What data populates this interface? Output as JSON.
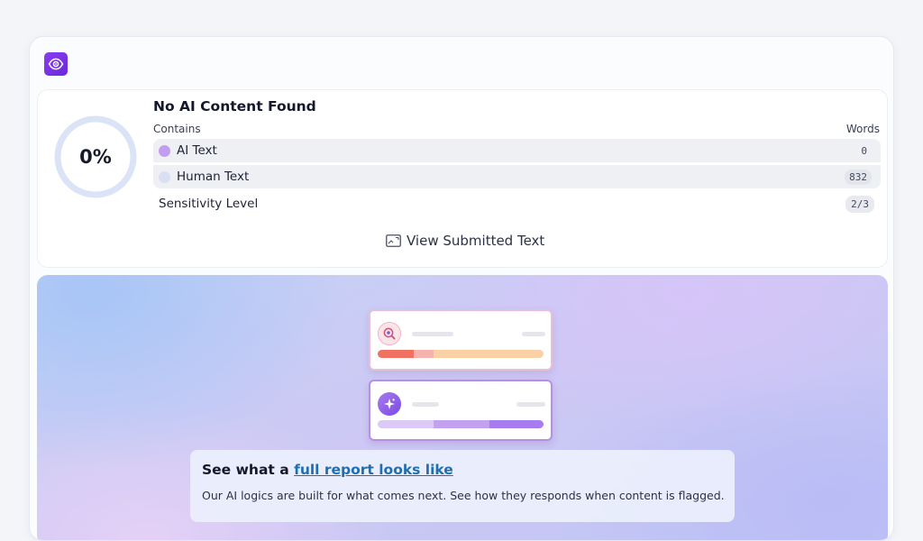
{
  "app": {
    "logo_icon": "eye-icon",
    "brand_color": "#7a33e8"
  },
  "result": {
    "percentage": "0%",
    "ai_fraction": 0,
    "title": "No AI Content Found",
    "contains_label": "Contains",
    "words_label": "Words",
    "rows": [
      {
        "label": "AI Text",
        "count": "0",
        "dot_color": "#c29ef0"
      },
      {
        "label": "Human Text",
        "count": "832",
        "dot_color": "#d9e0f2"
      }
    ],
    "sensitivity_label": "Sensitivity Level",
    "sensitivity_value": "2/3",
    "view_button_label": "View Submitted Text",
    "view_button_icon": "document-frame-icon"
  },
  "promo": {
    "heading_prefix": "See what a",
    "heading_link": "full report looks like",
    "description": "Our AI logics are built for what comes next. See how they responds when content is flagged.",
    "illustration": {
      "top_card_icon": "magnifier-eye-icon",
      "bottom_card_icon": "sparkle-icon"
    }
  }
}
